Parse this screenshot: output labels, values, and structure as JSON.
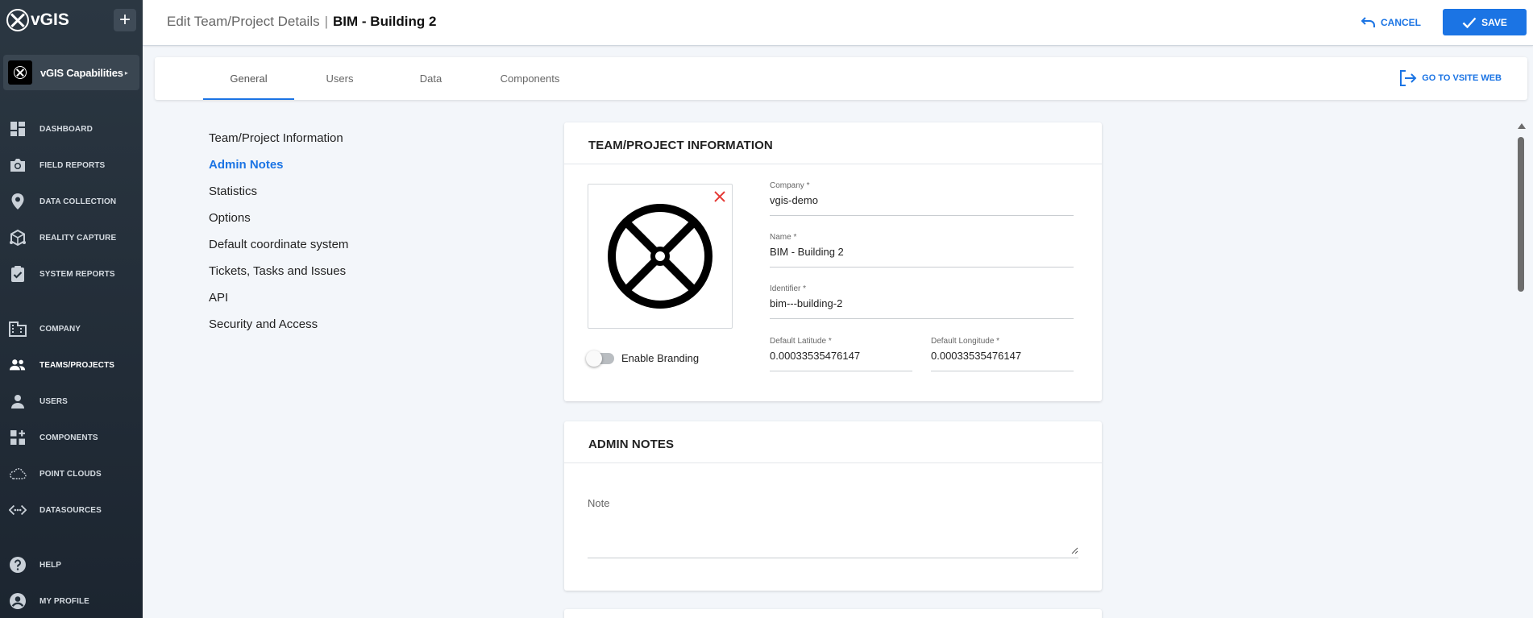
{
  "app": {
    "logo_text": "vGIS"
  },
  "sidebar": {
    "add_label": "+",
    "org_name": "vGIS Capabilities",
    "org_arrow": "▸",
    "items": [
      {
        "label": "DASHBOARD",
        "icon": "dashboard-icon"
      },
      {
        "label": "FIELD REPORTS",
        "icon": "camera-icon"
      },
      {
        "label": "DATA COLLECTION",
        "icon": "location-pin-icon"
      },
      {
        "label": "REALITY CAPTURE",
        "icon": "reality-capture-icon"
      },
      {
        "label": "SYSTEM REPORTS",
        "icon": "clipboard-check-icon"
      },
      {
        "label": "COMPANY",
        "icon": "building-icon"
      },
      {
        "label": "TEAMS/PROJECTS",
        "icon": "team-icon",
        "active": true
      },
      {
        "label": "USERS",
        "icon": "user-icon"
      },
      {
        "label": "COMPONENTS",
        "icon": "components-icon"
      },
      {
        "label": "POINT CLOUDS",
        "icon": "cloud-icon"
      },
      {
        "label": "DATASOURCES",
        "icon": "datasource-icon"
      },
      {
        "label": "HELP",
        "icon": "help-icon"
      },
      {
        "label": "MY PROFILE",
        "icon": "profile-icon"
      }
    ]
  },
  "header": {
    "title": "Edit Team/Project Details",
    "separator": "|",
    "project_name": "BIM - Building 2",
    "cancel_label": "CANCEL",
    "save_label": "SAVE"
  },
  "tabs": {
    "items": [
      "General",
      "Users",
      "Data",
      "Components"
    ],
    "active": "General",
    "goto_label": "GO TO VSITE WEB"
  },
  "section_nav": {
    "items": [
      "Team/Project Information",
      "Admin Notes",
      "Statistics",
      "Options",
      "Default coordinate system",
      "Tickets, Tasks and Issues",
      "API",
      "Security and Access"
    ],
    "active": "Admin Notes"
  },
  "info_card": {
    "title": "TEAM/PROJECT INFORMATION",
    "enable_branding_label": "Enable Branding",
    "enable_branding": false,
    "fields": {
      "company": {
        "label": "Company *",
        "value": "vgis-demo"
      },
      "name": {
        "label": "Name *",
        "value": "BIM - Building 2"
      },
      "identifier": {
        "label": "Identifier *",
        "value": "bim---building-2"
      },
      "latitude": {
        "label": "Default Latitude *",
        "value": "0.00033535476147"
      },
      "longitude": {
        "label": "Default Longitude *",
        "value": "0.00033535476147"
      }
    }
  },
  "notes_card": {
    "title": "ADMIN NOTES",
    "note_label": "Note",
    "note_value": ""
  },
  "colors": {
    "accent": "#1b74e4",
    "sidebar_top": "#2b3742",
    "sidebar_bottom": "#1c2530",
    "remove": "#e53935"
  }
}
